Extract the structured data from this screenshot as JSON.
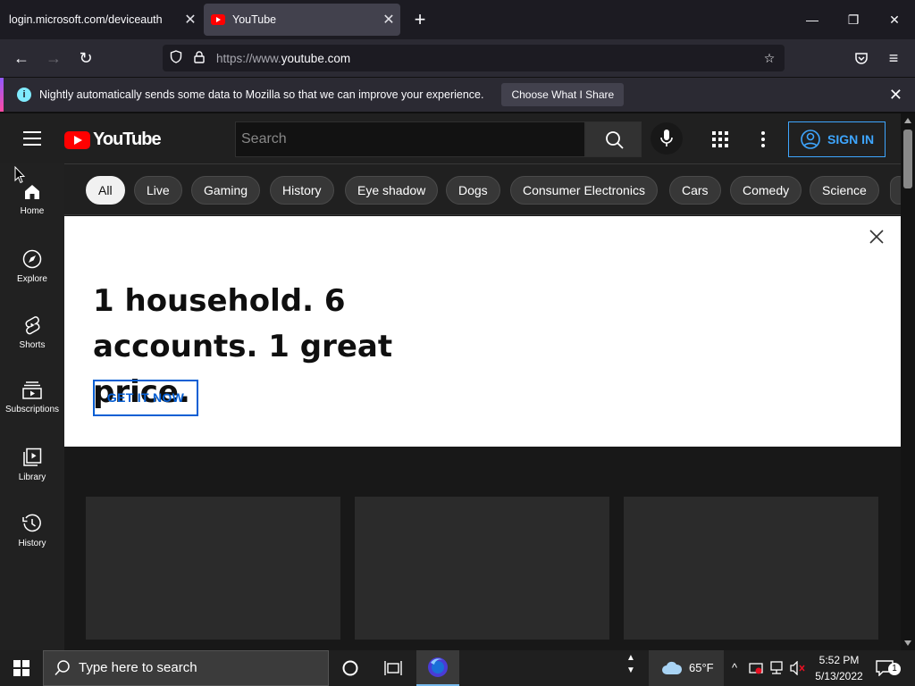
{
  "browser": {
    "tabs": [
      {
        "title": "login.microsoft.com/deviceauth",
        "active": false
      },
      {
        "title": "YouTube",
        "active": true
      }
    ],
    "url": {
      "prefix": "https://www.",
      "domain": "youtube.com"
    },
    "notification": {
      "text": "Nightly automatically sends some data to Mozilla so that we can improve your experience.",
      "button": "Choose What I Share"
    }
  },
  "youtube": {
    "logo_text": "YouTube",
    "search_placeholder": "Search",
    "sign_in": "SIGN IN",
    "accent": "#3ea6ff",
    "chips": [
      "All",
      "Live",
      "Gaming",
      "History",
      "Eye shadow",
      "Dogs",
      "Consumer Electronics",
      "Cars",
      "Comedy",
      "Science"
    ],
    "guide": [
      {
        "label": "Home",
        "icon": "home-icon"
      },
      {
        "label": "Explore",
        "icon": "compass-icon"
      },
      {
        "label": "Shorts",
        "icon": "shorts-icon"
      },
      {
        "label": "Subscriptions",
        "icon": "subscriptions-icon"
      },
      {
        "label": "Library",
        "icon": "library-icon"
      },
      {
        "label": "History",
        "icon": "history-icon"
      }
    ],
    "banner": {
      "title": "1 household. 6 accounts. 1 great price.",
      "cta": "GET IT NOW"
    }
  },
  "taskbar": {
    "search_placeholder": "Type here to search",
    "weather": "65°F",
    "time": "5:52 PM",
    "date": "5/13/2022",
    "notification_count": "1"
  }
}
